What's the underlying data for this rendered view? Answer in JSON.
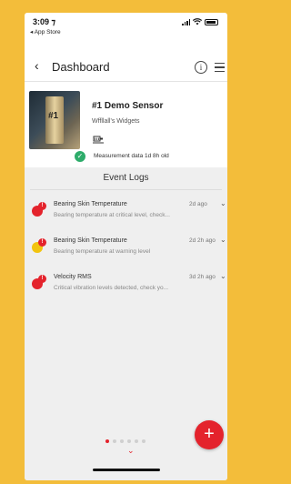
{
  "status_bar": {
    "time": "3:09 ⁊",
    "back_app": "◂ App Store"
  },
  "nav": {
    "title": "Dashboard"
  },
  "sensor": {
    "name": "#1 Demo Sensor",
    "organization": "Wffllall's Widgets",
    "photo_label": "#1",
    "status_text": "Measurement data 1d 8h old"
  },
  "event_logs": {
    "title": "Event Logs",
    "items": [
      {
        "title": "Bearing Skin Temperature",
        "time": "2d ago",
        "description": "Bearing temperature at critical level, check...",
        "severity": "critical",
        "colors": [
          "#e4232c",
          "#e4232c"
        ]
      },
      {
        "title": "Bearing Skin Temperature",
        "time": "2d 2h ago",
        "description": "Bearing temperature at warning level",
        "severity": "warning",
        "colors": [
          "#f2c40f",
          "#e4232c"
        ]
      },
      {
        "title": "Velocity RMS",
        "time": "3d 2h ago",
        "description": "Critical vibration levels detected, check yo...",
        "severity": "critical",
        "colors": [
          "#e4232c",
          "#e4232c"
        ]
      }
    ]
  },
  "pager": {
    "count": 6,
    "active_index": 0
  },
  "fab": {
    "label": "+"
  },
  "colors": {
    "accent": "#e4232c",
    "ok": "#2eac6b",
    "warning": "#f2c40f",
    "frame": "#f3bd3a"
  }
}
